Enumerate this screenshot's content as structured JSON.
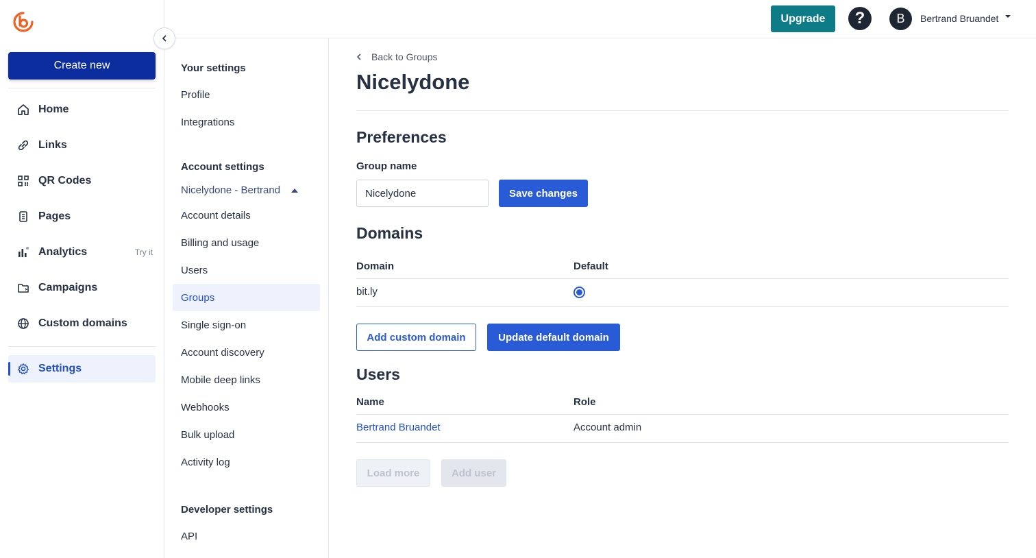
{
  "colors": {
    "brand_orange": "#ee6123",
    "create_button": "#0b2d9e",
    "upgrade_button": "#0e7c86",
    "primary_button": "#2a5bd7",
    "active_link": "#2350c8"
  },
  "leftnav": {
    "create_label": "Create new",
    "items": [
      {
        "label": "Home",
        "icon": "home-icon"
      },
      {
        "label": "Links",
        "icon": "link-icon"
      },
      {
        "label": "QR Codes",
        "icon": "qr-code-icon"
      },
      {
        "label": "Pages",
        "icon": "pages-icon"
      },
      {
        "label": "Analytics",
        "icon": "analytics-icon",
        "badge": "Try it"
      },
      {
        "label": "Campaigns",
        "icon": "campaigns-icon"
      },
      {
        "label": "Custom domains",
        "icon": "globe-icon"
      }
    ],
    "settings_label": "Settings"
  },
  "topbar": {
    "upgrade_label": "Upgrade",
    "help_symbol": "?",
    "avatar_initial": "B",
    "user_name": "Bertrand Bruandet"
  },
  "subnav": {
    "your_settings_heading": "Your settings",
    "your_settings_items": [
      "Profile",
      "Integrations"
    ],
    "account_settings_heading": "Account settings",
    "account_name": "Nicelydone - Bertrand",
    "account_items": [
      "Account details",
      "Billing and usage",
      "Users",
      "Groups",
      "Single sign-on",
      "Account discovery",
      "Mobile deep links",
      "Webhooks",
      "Bulk upload",
      "Activity log"
    ],
    "active_item": "Groups",
    "developer_heading": "Developer settings",
    "developer_items": [
      "API"
    ]
  },
  "main": {
    "back_label": "Back to Groups",
    "title": "Nicelydone",
    "preferences": {
      "heading": "Preferences",
      "group_name_label": "Group name",
      "group_name_value": "Nicelydone",
      "save_label": "Save changes"
    },
    "domains": {
      "heading": "Domains",
      "columns": [
        "Domain",
        "Default"
      ],
      "rows": [
        {
          "domain": "bit.ly",
          "is_default": true
        }
      ],
      "add_custom_label": "Add custom domain",
      "update_default_label": "Update default domain"
    },
    "users": {
      "heading": "Users",
      "columns": [
        "Name",
        "Role"
      ],
      "rows": [
        {
          "name": "Bertrand Bruandet",
          "role": "Account admin"
        }
      ],
      "load_more_label": "Load more",
      "add_user_label": "Add user"
    }
  }
}
